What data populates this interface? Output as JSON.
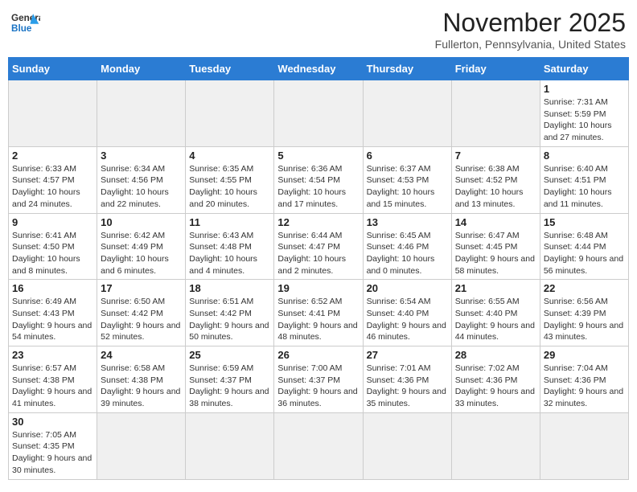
{
  "header": {
    "logo_text_general": "General",
    "logo_text_blue": "Blue",
    "month_title": "November 2025",
    "location": "Fullerton, Pennsylvania, United States"
  },
  "days_of_week": [
    "Sunday",
    "Monday",
    "Tuesday",
    "Wednesday",
    "Thursday",
    "Friday",
    "Saturday"
  ],
  "weeks": [
    [
      {
        "day": "",
        "info": ""
      },
      {
        "day": "",
        "info": ""
      },
      {
        "day": "",
        "info": ""
      },
      {
        "day": "",
        "info": ""
      },
      {
        "day": "",
        "info": ""
      },
      {
        "day": "",
        "info": ""
      },
      {
        "day": "1",
        "info": "Sunrise: 7:31 AM\nSunset: 5:59 PM\nDaylight: 10 hours\nand 27 minutes."
      }
    ],
    [
      {
        "day": "2",
        "info": "Sunrise: 6:33 AM\nSunset: 4:57 PM\nDaylight: 10 hours\nand 24 minutes."
      },
      {
        "day": "3",
        "info": "Sunrise: 6:34 AM\nSunset: 4:56 PM\nDaylight: 10 hours\nand 22 minutes."
      },
      {
        "day": "4",
        "info": "Sunrise: 6:35 AM\nSunset: 4:55 PM\nDaylight: 10 hours\nand 20 minutes."
      },
      {
        "day": "5",
        "info": "Sunrise: 6:36 AM\nSunset: 4:54 PM\nDaylight: 10 hours\nand 17 minutes."
      },
      {
        "day": "6",
        "info": "Sunrise: 6:37 AM\nSunset: 4:53 PM\nDaylight: 10 hours\nand 15 minutes."
      },
      {
        "day": "7",
        "info": "Sunrise: 6:38 AM\nSunset: 4:52 PM\nDaylight: 10 hours\nand 13 minutes."
      },
      {
        "day": "8",
        "info": "Sunrise: 6:40 AM\nSunset: 4:51 PM\nDaylight: 10 hours\nand 11 minutes."
      }
    ],
    [
      {
        "day": "9",
        "info": "Sunrise: 6:41 AM\nSunset: 4:50 PM\nDaylight: 10 hours\nand 8 minutes."
      },
      {
        "day": "10",
        "info": "Sunrise: 6:42 AM\nSunset: 4:49 PM\nDaylight: 10 hours\nand 6 minutes."
      },
      {
        "day": "11",
        "info": "Sunrise: 6:43 AM\nSunset: 4:48 PM\nDaylight: 10 hours\nand 4 minutes."
      },
      {
        "day": "12",
        "info": "Sunrise: 6:44 AM\nSunset: 4:47 PM\nDaylight: 10 hours\nand 2 minutes."
      },
      {
        "day": "13",
        "info": "Sunrise: 6:45 AM\nSunset: 4:46 PM\nDaylight: 10 hours\nand 0 minutes."
      },
      {
        "day": "14",
        "info": "Sunrise: 6:47 AM\nSunset: 4:45 PM\nDaylight: 9 hours\nand 58 minutes."
      },
      {
        "day": "15",
        "info": "Sunrise: 6:48 AM\nSunset: 4:44 PM\nDaylight: 9 hours\nand 56 minutes."
      }
    ],
    [
      {
        "day": "16",
        "info": "Sunrise: 6:49 AM\nSunset: 4:43 PM\nDaylight: 9 hours\nand 54 minutes."
      },
      {
        "day": "17",
        "info": "Sunrise: 6:50 AM\nSunset: 4:42 PM\nDaylight: 9 hours\nand 52 minutes."
      },
      {
        "day": "18",
        "info": "Sunrise: 6:51 AM\nSunset: 4:42 PM\nDaylight: 9 hours\nand 50 minutes."
      },
      {
        "day": "19",
        "info": "Sunrise: 6:52 AM\nSunset: 4:41 PM\nDaylight: 9 hours\nand 48 minutes."
      },
      {
        "day": "20",
        "info": "Sunrise: 6:54 AM\nSunset: 4:40 PM\nDaylight: 9 hours\nand 46 minutes."
      },
      {
        "day": "21",
        "info": "Sunrise: 6:55 AM\nSunset: 4:40 PM\nDaylight: 9 hours\nand 44 minutes."
      },
      {
        "day": "22",
        "info": "Sunrise: 6:56 AM\nSunset: 4:39 PM\nDaylight: 9 hours\nand 43 minutes."
      }
    ],
    [
      {
        "day": "23",
        "info": "Sunrise: 6:57 AM\nSunset: 4:38 PM\nDaylight: 9 hours\nand 41 minutes."
      },
      {
        "day": "24",
        "info": "Sunrise: 6:58 AM\nSunset: 4:38 PM\nDaylight: 9 hours\nand 39 minutes."
      },
      {
        "day": "25",
        "info": "Sunrise: 6:59 AM\nSunset: 4:37 PM\nDaylight: 9 hours\nand 38 minutes."
      },
      {
        "day": "26",
        "info": "Sunrise: 7:00 AM\nSunset: 4:37 PM\nDaylight: 9 hours\nand 36 minutes."
      },
      {
        "day": "27",
        "info": "Sunrise: 7:01 AM\nSunset: 4:36 PM\nDaylight: 9 hours\nand 35 minutes."
      },
      {
        "day": "28",
        "info": "Sunrise: 7:02 AM\nSunset: 4:36 PM\nDaylight: 9 hours\nand 33 minutes."
      },
      {
        "day": "29",
        "info": "Sunrise: 7:04 AM\nSunset: 4:36 PM\nDaylight: 9 hours\nand 32 minutes."
      }
    ],
    [
      {
        "day": "30",
        "info": "Sunrise: 7:05 AM\nSunset: 4:35 PM\nDaylight: 9 hours\nand 30 minutes."
      },
      {
        "day": "",
        "info": ""
      },
      {
        "day": "",
        "info": ""
      },
      {
        "day": "",
        "info": ""
      },
      {
        "day": "",
        "info": ""
      },
      {
        "day": "",
        "info": ""
      },
      {
        "day": "",
        "info": ""
      }
    ]
  ]
}
